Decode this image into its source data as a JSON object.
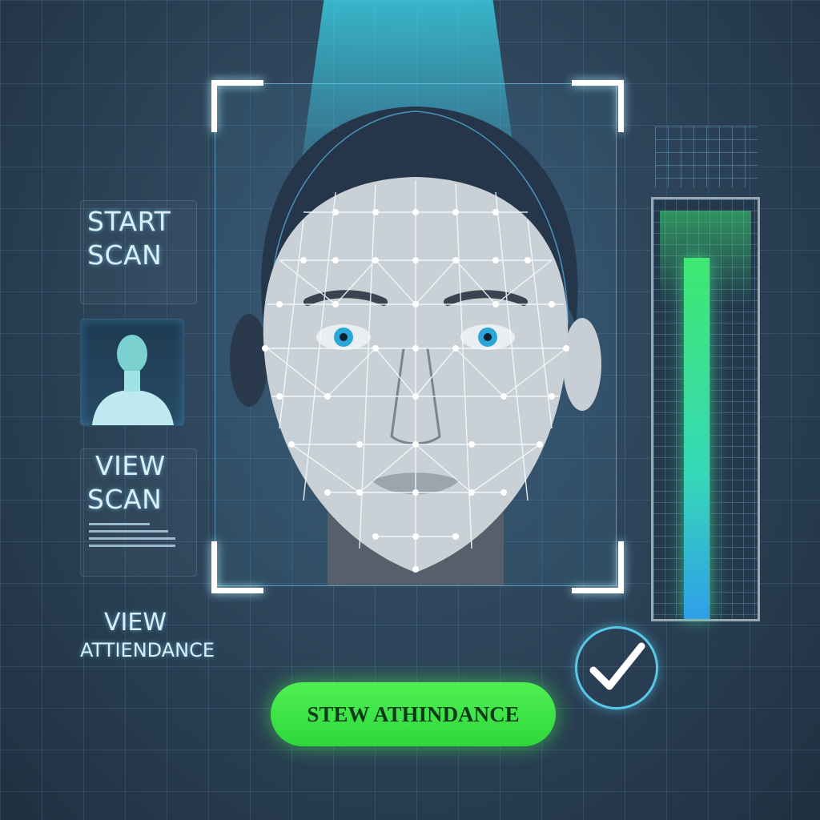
{
  "menu": {
    "start_scan": [
      "START",
      "SCAN"
    ],
    "view_scan": [
      "VIEW",
      "SCAN"
    ],
    "view_attendance": [
      "VIEW",
      "ATTIENDANCE"
    ]
  },
  "attendance_button": {
    "label": "STEW ATHINDANCE"
  },
  "scan_level": {
    "fill_fraction": 0.86
  },
  "colors": {
    "accent_cyan": "#59c7e6",
    "success_green": "#3fe870",
    "background": "#2b4156"
  },
  "icons": {
    "status": "check-icon",
    "avatar": "user-avatar-icon",
    "face": "face-mesh-icon"
  }
}
